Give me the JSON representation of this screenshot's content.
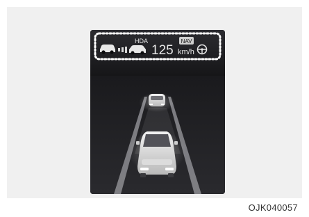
{
  "cluster": {
    "hda_label": "HDA",
    "speed": "125",
    "nav_badge": "NAV",
    "unit": "km/h",
    "steering_icon": "steering-wheel-icon",
    "lead_vehicle_icon": "lead-car-icon",
    "own_vehicle_icon": "own-car-icon",
    "following_distance_icon": "distance-bars-icon"
  },
  "caption": {
    "code": "OJK040057"
  },
  "colors": {
    "screen_bg": "#0b0b0d",
    "frame_bg": "#f0f0f0",
    "highlight_dots": "#ffffff"
  }
}
